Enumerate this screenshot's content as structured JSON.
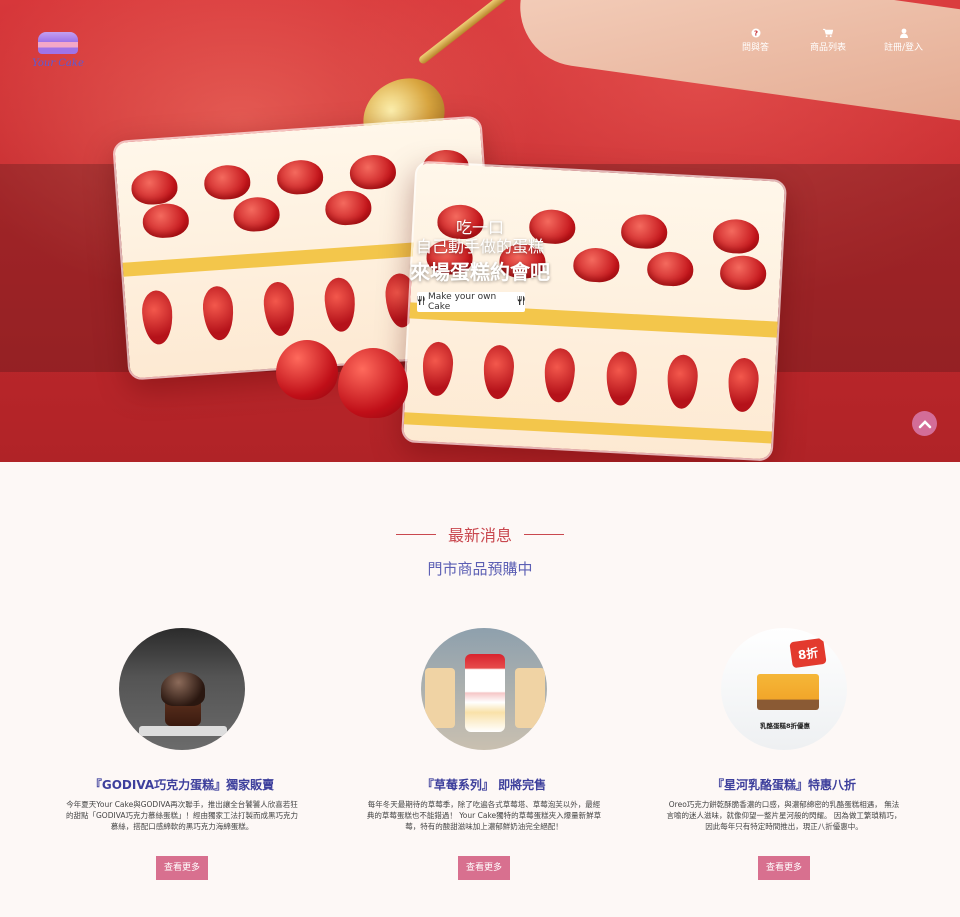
{
  "brand": {
    "logo_text": "Your Cake"
  },
  "nav": {
    "faq": {
      "label": "問與答",
      "icon": "question-circle-icon"
    },
    "products": {
      "label": "商品列表",
      "icon": "cart-icon"
    },
    "login": {
      "label": "註冊/登入",
      "icon": "user-icon"
    }
  },
  "hero": {
    "line1": "吃一口",
    "line2": "自己動手做的蛋糕",
    "line3": "來場蛋糕約會吧",
    "cta_label": "Make your own Cake",
    "cta_icon": "utensils-icon",
    "scroll_top_icon": "chevron-up-icon"
  },
  "news": {
    "title": "最新消息",
    "subtitle": "門市商品預購中",
    "cards": [
      {
        "title": "『GODIVA巧克力蛋糕』獨家販賣",
        "desc": "今年夏天Your Cake與GODIVA再次聯手，推出讓全台饕饕人欣喜若狂的甜點「GODIVA巧克力慕絲蛋糕」！經由獨家工法打製而成黑巧克力慕絲，搭配口感綿軟的黑巧克力海綿蛋糕。",
        "more": "查看更多"
      },
      {
        "title": "『草莓系列』 即將完售",
        "desc": "每年冬天最期待的草莓季，除了吃遍各式草莓塔、草莓泡芙以外，最經典的草莓蛋糕也不能錯過！ Your Cake獨特的草莓蛋糕夾入爆量新鮮草莓，特有的酸甜滋味加上濃郁鮮奶油完全絕配！",
        "more": "查看更多"
      },
      {
        "title": "『星河乳酪蛋糕』特惠八折",
        "desc": "Oreo巧克力餅乾酥脆香濃的口感，與濃郁綿密的乳酪蛋糕相遇， 無法言喻的迷人滋味，就像仰望一整片星河般的閃耀。 因為做工繁瑣精巧，因此每年只有特定時間推出，現正八折優惠中。",
        "more": "查看更多",
        "badge": "8折",
        "image_caption": "乳酪蛋糕8折優惠"
      }
    ]
  }
}
